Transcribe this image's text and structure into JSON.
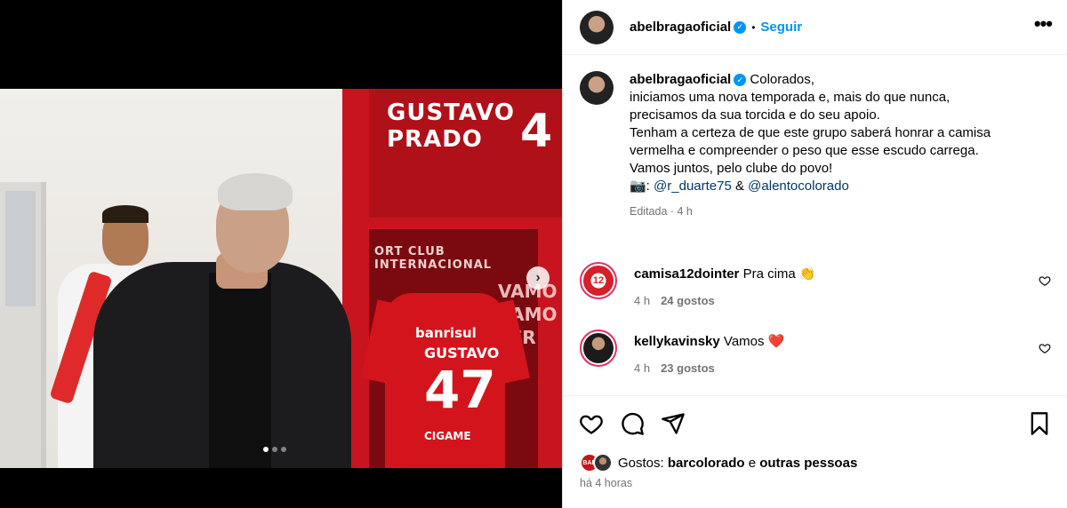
{
  "post": {
    "username": "abelbragaoficial",
    "follow_label": "Seguir",
    "separator": "•",
    "more_label": "•••",
    "verified_symbol": "✓"
  },
  "media": {
    "locker_name_line1": "GUSTAVO",
    "locker_name_line2": "PRADO",
    "locker_number": "4",
    "locker_club_text": "ORT CLUB INTERNACIONAL",
    "shirt_sponsor": "banrisul",
    "shirt_name": "GUSTAVO",
    "shirt_number": "47",
    "shirt_sponsor2": "CIGAME",
    "graffiti": "VAMO\nVAMO\nTER",
    "next_arrow": "›",
    "dots": [
      true,
      false,
      false
    ]
  },
  "caption": {
    "username": "abelbragaoficial",
    "line1": "Colorados,",
    "line2": "iniciamos uma nova temporada e, mais do que nunca,",
    "line3": "precisamos da sua torcida e do seu apoio.",
    "line4": "Tenham a certeza de que este grupo saberá honrar a camisa",
    "line5": "vermelha e compreender o peso que esse escudo carrega.",
    "line6": "Vamos juntos, pelo clube do povo!",
    "camera_emoji": "📷:",
    "mention1": "@r_duarte75",
    "amp": "&",
    "mention2": "@alentocolorado",
    "edited": "Editada · 4 h"
  },
  "comments": [
    {
      "username": "camisa12dointer",
      "text": "Pra cima",
      "emoji": "👏",
      "avatar_text": "12",
      "time": "4 h",
      "likes": "24 gostos"
    },
    {
      "username": "kellykavinsky",
      "text": "Vamos",
      "emoji": "❤️",
      "time": "4 h",
      "likes": "23 gostos"
    }
  ],
  "footer": {
    "likes_prefix": "Gostos:",
    "likes_user": "barcolorado",
    "likes_and": "e",
    "likes_others": "outras pessoas",
    "like_avatar_text": "BAR",
    "time": "há 4 horas"
  },
  "colors": {
    "accent": "#0095f6",
    "mention": "#00376b",
    "secondary_text": "#737373"
  }
}
